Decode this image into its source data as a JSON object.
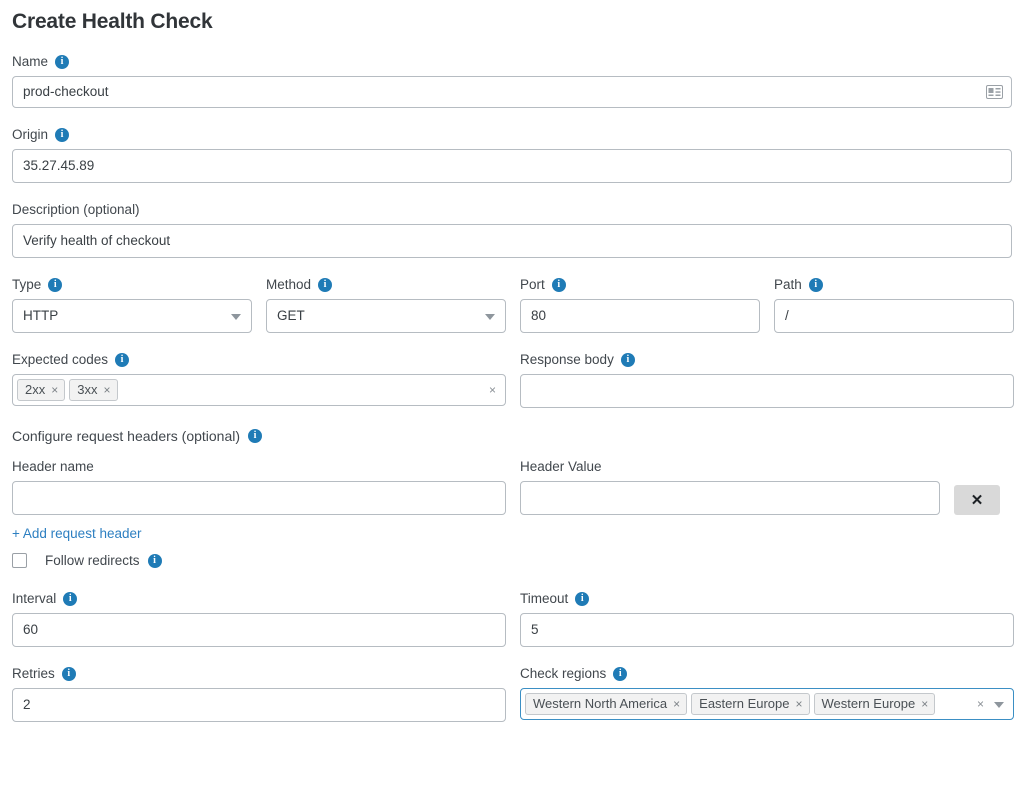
{
  "page": {
    "title": "Create Health Check"
  },
  "fields": {
    "name": {
      "label": "Name",
      "value": "prod-checkout",
      "icon": "contact-card-autofill-icon"
    },
    "origin": {
      "label": "Origin",
      "value": "35.27.45.89"
    },
    "description": {
      "label": "Description (optional)",
      "value": "Verify health of checkout"
    },
    "type": {
      "label": "Type",
      "value": "HTTP"
    },
    "method": {
      "label": "Method",
      "value": "GET"
    },
    "port": {
      "label": "Port",
      "value": "80"
    },
    "path": {
      "label": "Path",
      "value": "/"
    },
    "expected_codes": {
      "label": "Expected codes",
      "chips": [
        "2xx",
        "3xx"
      ],
      "clear_label": "×"
    },
    "response_body": {
      "label": "Response body",
      "value": ""
    },
    "interval": {
      "label": "Interval",
      "value": "60"
    },
    "timeout": {
      "label": "Timeout",
      "value": "5"
    },
    "retries": {
      "label": "Retries",
      "value": "2"
    },
    "check_regions": {
      "label": "Check regions",
      "chips": [
        "Western North America",
        "Eastern Europe",
        "Western Europe"
      ],
      "clear_label": "×"
    }
  },
  "headers_section": {
    "title": "Configure request headers (optional)",
    "header_name_label": "Header name",
    "header_name_value": "",
    "header_value_label": "Header Value",
    "header_value_value": "",
    "delete_label": "✕",
    "add_link": "+ Add request header"
  },
  "follow_redirects": {
    "label": "Follow redirects",
    "checked": false
  },
  "chip_remove_label": "×",
  "colors": {
    "accent_blue": "#1f7bb6",
    "link_blue": "#2d7fc1",
    "focus_border": "#3b8fc4",
    "border_grey": "#b6bcc2",
    "chip_bg": "#f2f2f2",
    "text": "#3a4045"
  }
}
